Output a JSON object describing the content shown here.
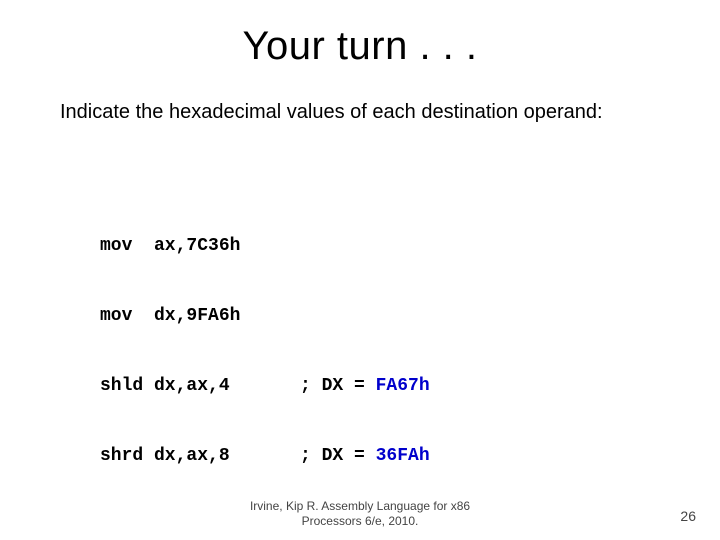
{
  "title": "Your turn . . .",
  "prompt": "Indicate the hexadecimal values of each destination operand:",
  "code": {
    "lines": [
      {
        "instr": "mov  ax,7C36h",
        "comment": "",
        "answer": ""
      },
      {
        "instr": "mov  dx,9FA6h",
        "comment": "",
        "answer": ""
      },
      {
        "instr": "shld dx,ax,4",
        "comment": "; DX = ",
        "answer": "FA67h"
      },
      {
        "instr": "shrd dx,ax,8",
        "comment": "; DX = ",
        "answer": "36FAh"
      }
    ]
  },
  "footer_line1": "Irvine, Kip R. Assembly Language for x86",
  "footer_line2": "Processors 6/e, 2010.",
  "page_number": "26"
}
